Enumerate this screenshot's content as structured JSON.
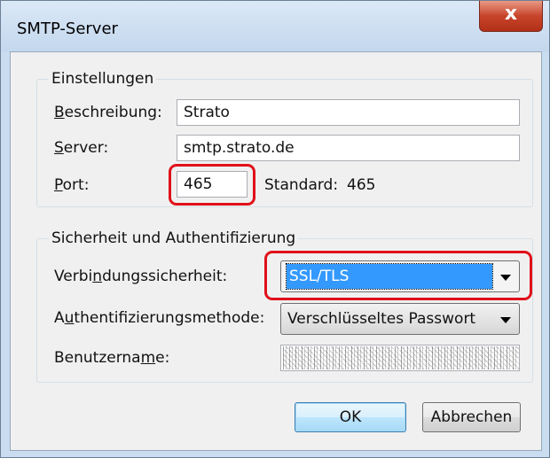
{
  "window": {
    "title": "SMTP-Server",
    "close_symbol": "x"
  },
  "settings": {
    "legend": "Einstellungen",
    "description_label": "Beschreibung:",
    "description_value": "Strato",
    "server_label": "Server:",
    "server_value": "smtp.strato.de",
    "port_label": "Port:",
    "port_value": "465",
    "default_label": "Standard:",
    "default_value": "465"
  },
  "security": {
    "legend": "Sicherheit und Authentifizierung",
    "connection_label": "Verbindungssicherheit:",
    "connection_value": "SSL/TLS",
    "auth_label": "Authentifizierungsmethode:",
    "auth_value": "Verschlüsseltes Passwort",
    "username_label": "Benutzername:"
  },
  "buttons": {
    "ok": "OK",
    "cancel": "Abbrechen"
  },
  "colors": {
    "highlight_border": "#e0101a",
    "selection": "#3399ff",
    "close_button": "#c8442b"
  }
}
